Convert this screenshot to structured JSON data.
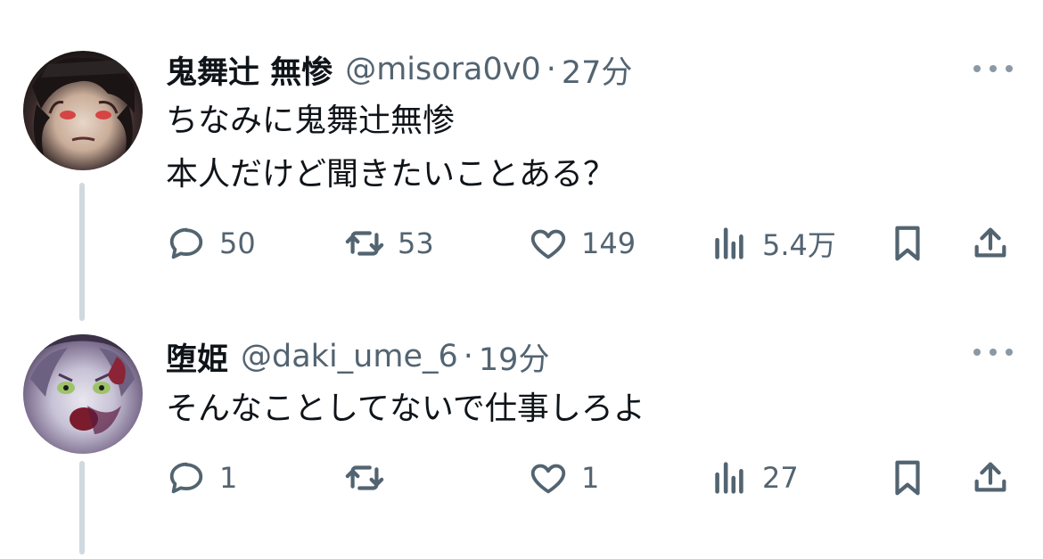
{
  "tweets": [
    {
      "display_name": "鬼舞辻 無惨",
      "handle": "@misora0v0",
      "separator": "·",
      "time": "27分",
      "lines": [
        "ちなみに鬼舞辻無惨",
        "本人だけど聞きたいことある？"
      ],
      "replies": "50",
      "retweets": "53",
      "likes": "149",
      "views": "5.4万"
    },
    {
      "display_name": "堕姫",
      "handle": "@daki_ume_6",
      "separator": "·",
      "time": "19分",
      "lines": [
        "そんなことしてないで仕事しろよ"
      ],
      "replies": "1",
      "retweets": "",
      "likes": "1",
      "views": "27"
    }
  ],
  "icons": {
    "reply": "speech-bubble-icon",
    "retweet": "retweet-arrows-icon",
    "like": "heart-icon",
    "views": "bar-chart-icon",
    "bookmark": "bookmark-icon",
    "share": "share-upload-icon",
    "more": "ellipsis-icon"
  },
  "colors": {
    "text_primary": "#0f1419",
    "text_secondary": "#536471",
    "thread_line": "#cfd9de"
  }
}
